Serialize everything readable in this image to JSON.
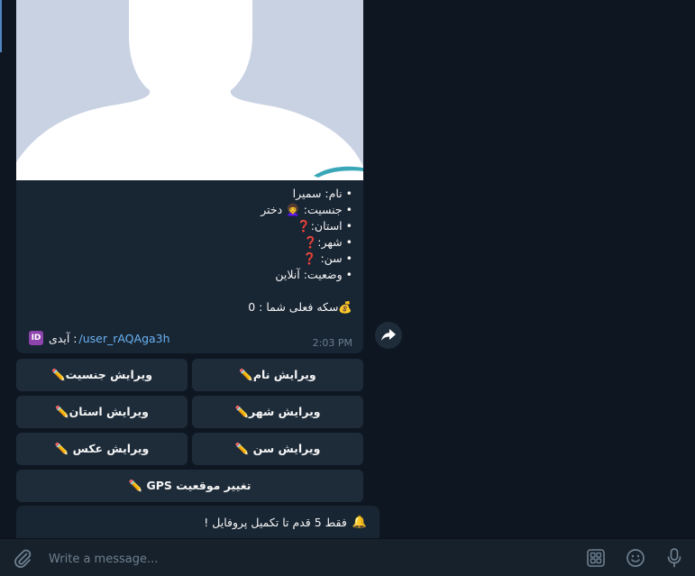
{
  "message": {
    "caption_lines": [
      {
        "text": "• نام: سمیرا"
      },
      {
        "text": "• جنسیت: 👩‍🦱 دختر"
      },
      {
        "text": "• استان:❓"
      },
      {
        "text": "• شهر:❓"
      },
      {
        "text": "• سن: ❓"
      },
      {
        "text": "• وضعیت: آنلاین"
      }
    ],
    "coins": "💰سکه فعلی شما : 0",
    "id_label": ": آیدی",
    "id_icon_text": "ID",
    "id_link": "/user_rAQAga3h",
    "time": "2:03 PM"
  },
  "keyboard": {
    "rows": [
      [
        {
          "label": "ویرایش جنسیت✏️"
        },
        {
          "label": "ویرایش نام✏️"
        }
      ],
      [
        {
          "label": "ویرایش استان✏️"
        },
        {
          "label": "ویرایش شهر✏️"
        }
      ],
      [
        {
          "label": "ویرایش عکس ✏️"
        },
        {
          "label": "ویرایش سن ✏️"
        }
      ],
      [
        {
          "label": "تغییر موقعیت GPS ✏️"
        }
      ]
    ]
  },
  "notice": {
    "bell": "🔔",
    "text": "فقط 5 قدم تا تکمیل پروفایل !"
  },
  "input": {
    "placeholder": "Write a message..."
  },
  "icons": {
    "attach": "paperclip-icon",
    "forward": "forward-arrow-icon",
    "commands": "bot-commands-icon",
    "emoji": "emoji-icon",
    "mic": "microphone-icon"
  },
  "colors": {
    "background": "#0e1621",
    "bubble": "#182533",
    "button": "#1e2c3a",
    "link": "#6ab3f3",
    "muted": "#6d7f8f"
  }
}
